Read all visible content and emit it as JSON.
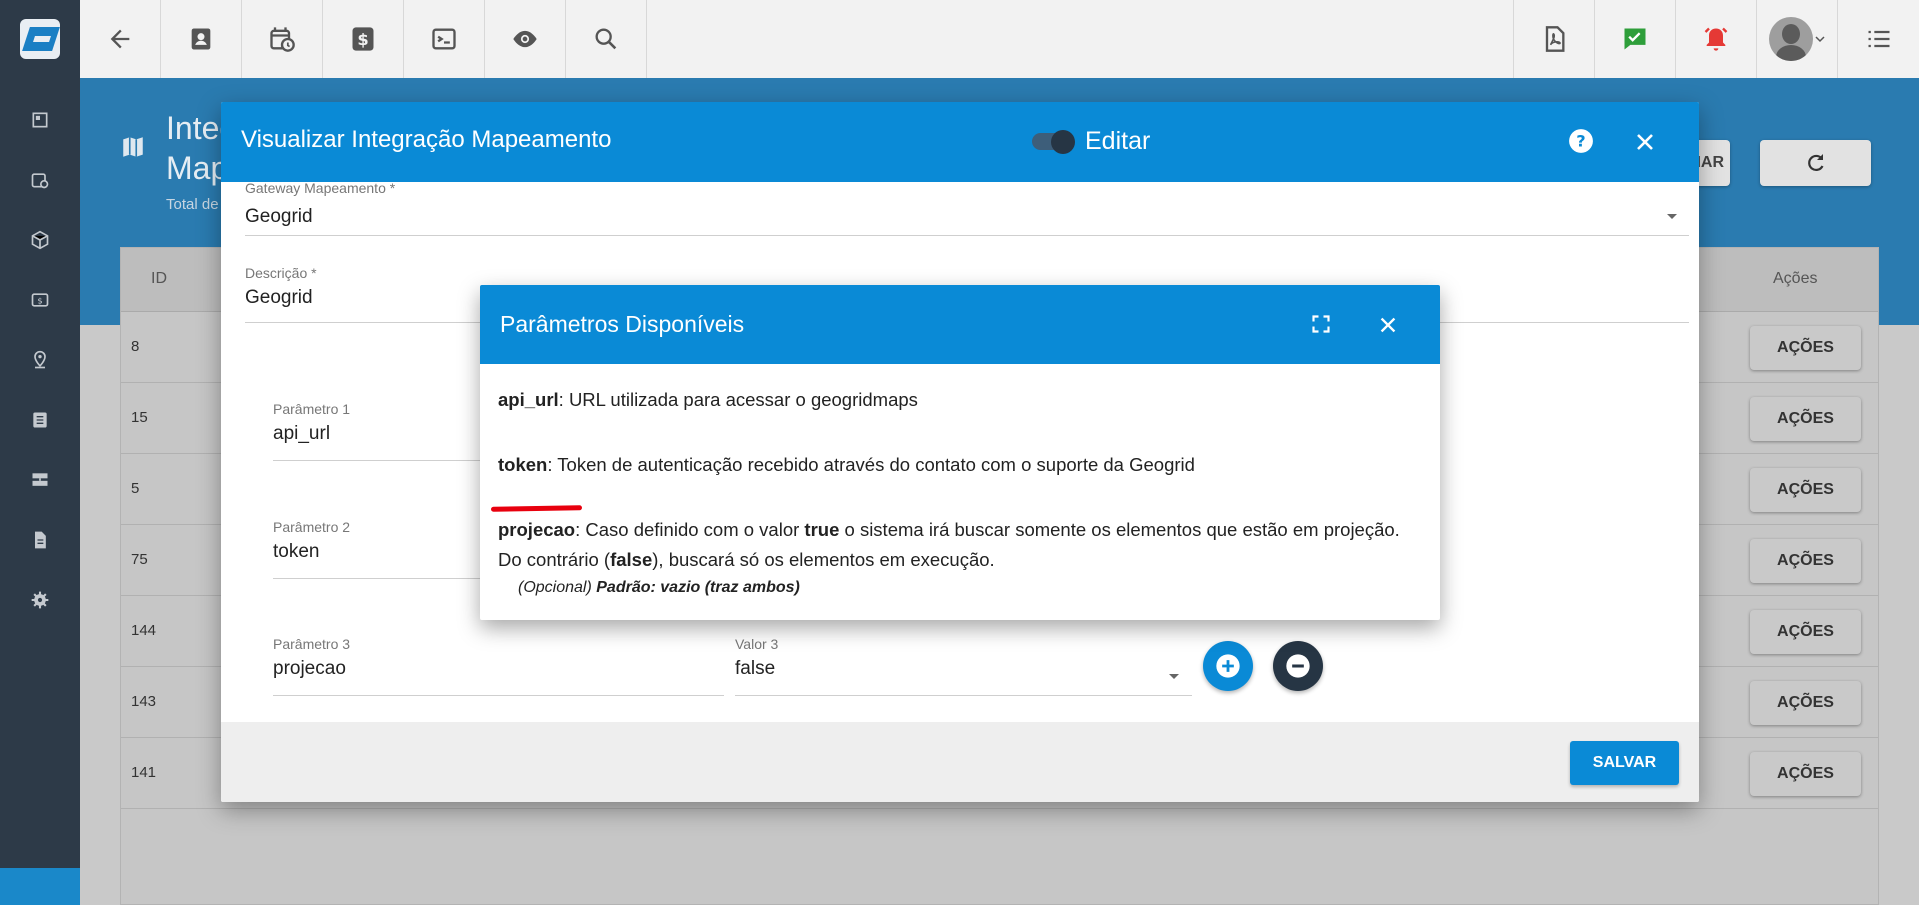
{
  "topbar": {
    "buttons": [
      "back-icon",
      "contact-icon",
      "calendar-clock-icon",
      "dollar-icon",
      "terminal-icon",
      "eye-icon",
      "search-icon"
    ],
    "right_buttons": [
      "pdf-icon",
      "check-icon",
      "alarm-icon",
      "avatar",
      "list-icon"
    ]
  },
  "sidebar": {
    "items": [
      "dashboard-icon",
      "calendar-icon",
      "package-icon",
      "money-icon",
      "map-pin-icon",
      "list-icon",
      "server-icon",
      "document-icon",
      "settings-icon"
    ]
  },
  "page_header": {
    "title_line1": "Integ",
    "title_line2": "Map",
    "subtitle": "Total de",
    "button_partial": "NAR"
  },
  "table": {
    "columns": {
      "id": "ID",
      "actions": "Ações"
    },
    "rows": [
      {
        "id": "8",
        "action_label": "AÇÕES"
      },
      {
        "id": "15",
        "action_label": "AÇÕES"
      },
      {
        "id": "5",
        "action_label": "AÇÕES"
      },
      {
        "id": "75",
        "action_label": "AÇÕES"
      },
      {
        "id": "144",
        "action_label": "AÇÕES"
      },
      {
        "id": "143",
        "action_label": "AÇÕES"
      },
      {
        "id": "141",
        "action_label": "AÇÕES"
      }
    ]
  },
  "dialog": {
    "title": "Visualizar Integração Mapeamento",
    "toggle_label": "Editar",
    "toggle_on": true,
    "gateway": {
      "label": "Gateway Mapeamento *",
      "value": "Geogrid"
    },
    "descricao": {
      "label": "Descrição *",
      "value": "Geogrid"
    },
    "params": [
      {
        "label": "Parâmetro 1",
        "value": "api_url"
      },
      {
        "label": "Parâmetro 2",
        "value": "token"
      },
      {
        "label": "Parâmetro 3",
        "value": "projecao"
      }
    ],
    "valor3": {
      "label": "Valor 3",
      "value": "false"
    },
    "save_label": "SALVAR"
  },
  "popup": {
    "title": "Parâmetros Disponíveis",
    "p1_key": "api_url",
    "p1_text": ": URL utilizada para acessar o geogridmaps",
    "p2_key": "token",
    "p2_text": ": Token de autenticação recebido através do contato com o suporte da Geogrid",
    "p3_key": "projecao",
    "p3_text_a": ": Caso definido com o valor ",
    "p3_true": "true",
    "p3_text_b": " o sistema irá buscar somente os elementos que estão em projeção. Do contrário (",
    "p3_false": "false",
    "p3_text_c": "), buscará só os elementos em execução.",
    "p3_note_a": "(Opcional) ",
    "p3_note_b": "Padrão: vazio (traz ambos)"
  },
  "colors": {
    "primary": "#0a8ad6",
    "dark": "#263544",
    "sidebar": "#2d3a48",
    "highlight": "#e8000e",
    "check": "#2e9e3a",
    "alarm": "#e53935"
  }
}
